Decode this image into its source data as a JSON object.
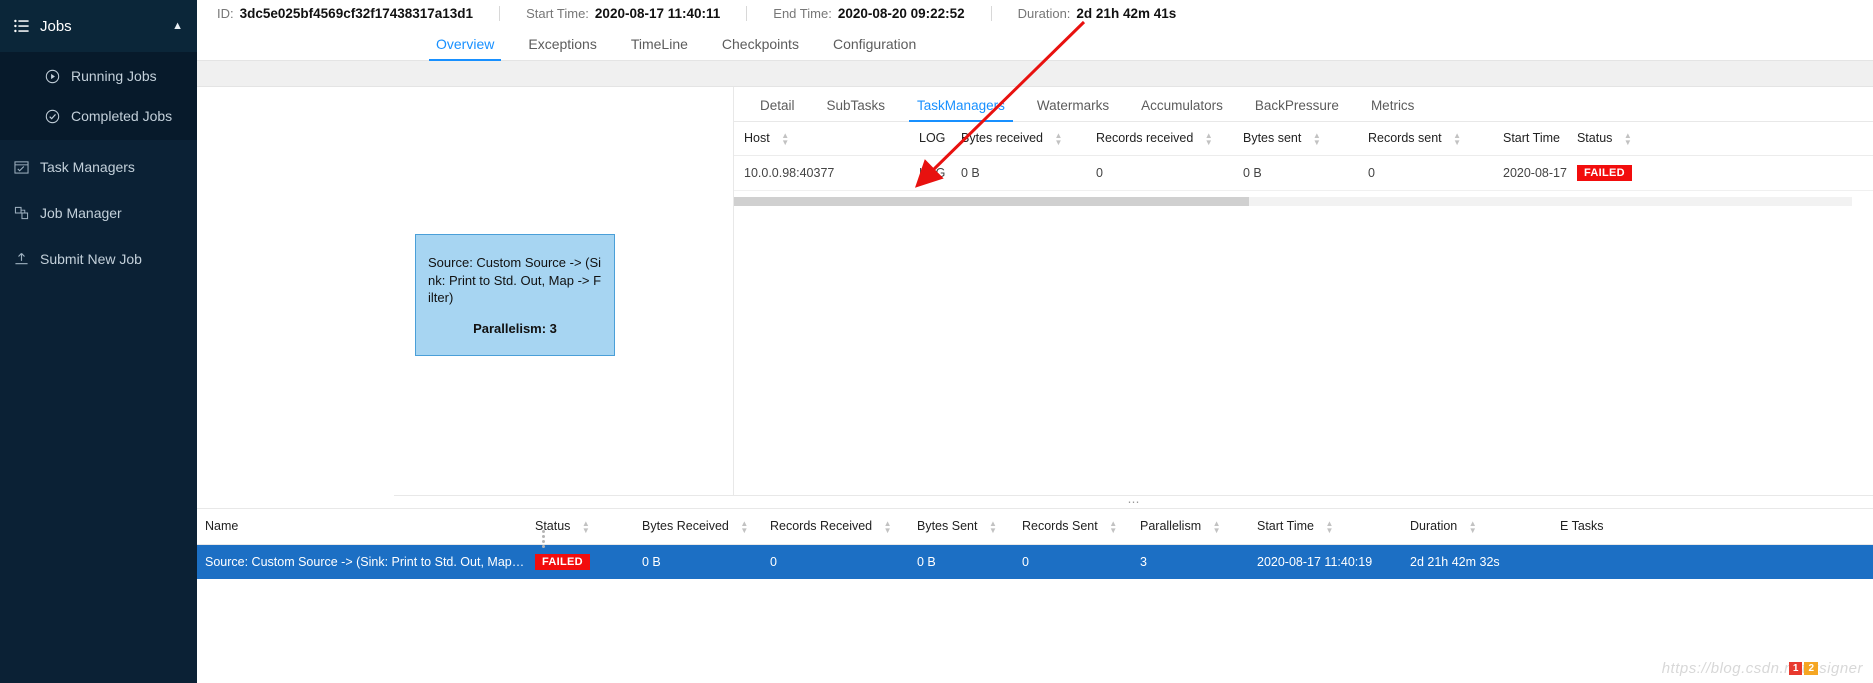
{
  "sidebar": {
    "group": {
      "label": "Jobs",
      "icon": "list-icon",
      "chevron": "chevron-up-icon"
    },
    "sub_items": [
      {
        "label": "Running Jobs",
        "icon": "play-circle-icon"
      },
      {
        "label": "Completed Jobs",
        "icon": "check-circle-icon"
      }
    ],
    "items": [
      {
        "label": "Task Managers",
        "icon": "task-manager-icon"
      },
      {
        "label": "Job Manager",
        "icon": "job-manager-icon"
      },
      {
        "label": "Submit New Job",
        "icon": "upload-icon"
      }
    ]
  },
  "job_header": {
    "id_label": "ID:",
    "id_value": "3dc5e025bf4569cf32f17438317a13d1",
    "start_label": "Start Time:",
    "start_value": "2020-08-17 11:40:11",
    "end_label": "End Time:",
    "end_value": "2020-08-20 09:22:52",
    "duration_label": "Duration:",
    "duration_value": "2d 21h 42m 41s"
  },
  "main_tabs": [
    {
      "label": "Overview",
      "active": true
    },
    {
      "label": "Exceptions",
      "active": false
    },
    {
      "label": "TimeLine",
      "active": false
    },
    {
      "label": "Checkpoints",
      "active": false
    },
    {
      "label": "Configuration",
      "active": false
    }
  ],
  "graph": {
    "node_title": "Source: Custom Source -> (Sink: Print to Std. Out, Map -> Filter)",
    "node_parallelism": "Parallelism: 3",
    "expand_right_icon": "chevron-right-icon",
    "collapse_left_icon": "chevron-left-icon"
  },
  "detail_tabs": [
    {
      "label": "Detail",
      "active": false
    },
    {
      "label": "SubTasks",
      "active": false
    },
    {
      "label": "TaskManagers",
      "active": true
    },
    {
      "label": "Watermarks",
      "active": false
    },
    {
      "label": "Accumulators",
      "active": false
    },
    {
      "label": "BackPressure",
      "active": false
    },
    {
      "label": "Metrics",
      "active": false
    }
  ],
  "taskmanagers_table": {
    "columns": [
      {
        "label": "Host",
        "sortable": true
      },
      {
        "label": "LOG",
        "sortable": false
      },
      {
        "label": "Bytes received",
        "sortable": true
      },
      {
        "label": "Records received",
        "sortable": true
      },
      {
        "label": "Bytes sent",
        "sortable": true
      },
      {
        "label": "Records sent",
        "sortable": true
      },
      {
        "label": "Start Time",
        "sortable": false
      },
      {
        "label": "Status",
        "sortable": true
      }
    ],
    "rows": [
      {
        "host": "10.0.0.98:40377",
        "log": "LOG",
        "bytes_received": "0 B",
        "records_received": "0",
        "bytes_sent": "0 B",
        "records_sent": "0",
        "start_time": "2020-08-17 ",
        "status": "FAILED"
      }
    ]
  },
  "subtasks_table": {
    "columns": [
      {
        "label": "Name",
        "sortable": false
      },
      {
        "label": "Status",
        "sortable": true
      },
      {
        "label": "Bytes Received",
        "sortable": true
      },
      {
        "label": "Records Received",
        "sortable": true
      },
      {
        "label": "Bytes Sent",
        "sortable": true
      },
      {
        "label": "Records Sent",
        "sortable": true
      },
      {
        "label": "Parallelism",
        "sortable": true
      },
      {
        "label": "Start Time",
        "sortable": true
      },
      {
        "label": "Duration",
        "sortable": true
      },
      {
        "label": "E Tasks",
        "sortable": false
      }
    ],
    "rows": [
      {
        "name": "Source: Custom Source -> (Sink: Print to Std. Out, Map -> Filter)",
        "status": "FAILED",
        "bytes_received": "0 B",
        "records_received": "0",
        "bytes_sent": "0 B",
        "records_sent": "0",
        "parallelism": "3",
        "start_time": "2020-08-17 11:40:19",
        "duration": "2d 21h 42m 32s",
        "tasks": ""
      }
    ]
  },
  "watermark": {
    "text": "https://blog.csdn.net/zsigner",
    "badge_red": "1",
    "badge_orange": "2"
  },
  "colors": {
    "sidebar_bg": "#0b2135",
    "accent": "#1890ff",
    "failed": "#f20d0d",
    "node_fill": "#a7d5f2",
    "node_border": "#4a9fd8",
    "row_selected": "#1c6fc4",
    "arrow_annotation": "#e8110f"
  }
}
